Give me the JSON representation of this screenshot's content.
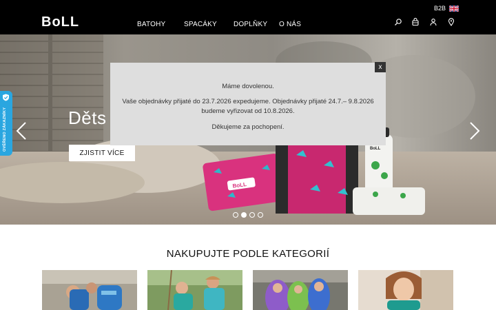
{
  "header": {
    "logo_text": "BoLL",
    "nav": [
      "BATOHY",
      "SPACÁKY",
      "DOPLŇKY",
      "O NÁS"
    ],
    "b2b": "B2B",
    "icons": [
      "search-icon",
      "basket-icon",
      "user-icon",
      "location-icon"
    ]
  },
  "hero": {
    "title": "Děts",
    "button": "ZJISTIT VÍCE",
    "slide_count": 4,
    "active_slide": 2
  },
  "side_tab": {
    "label": "OVĚŘENO ZÁKAZNÍKY",
    "color": "#2aa6e0"
  },
  "modal": {
    "line1": "Máme dovolenou.",
    "line2": "Vaše objednávky přijaté do 23.7.2026 expedujeme. Objednávky přijaté 24.7.– 9.8.2026 budeme vyřizovat od 10.8.2026.",
    "line3": "Děkujeme za pochopení.",
    "close": "x"
  },
  "categories": {
    "title": "NAKUPUJTE PODLE KATEGORIÍ"
  },
  "colors": {
    "header_bg": "#000000",
    "modal_bg": "#dedede",
    "accent": "#2aa6e0"
  }
}
